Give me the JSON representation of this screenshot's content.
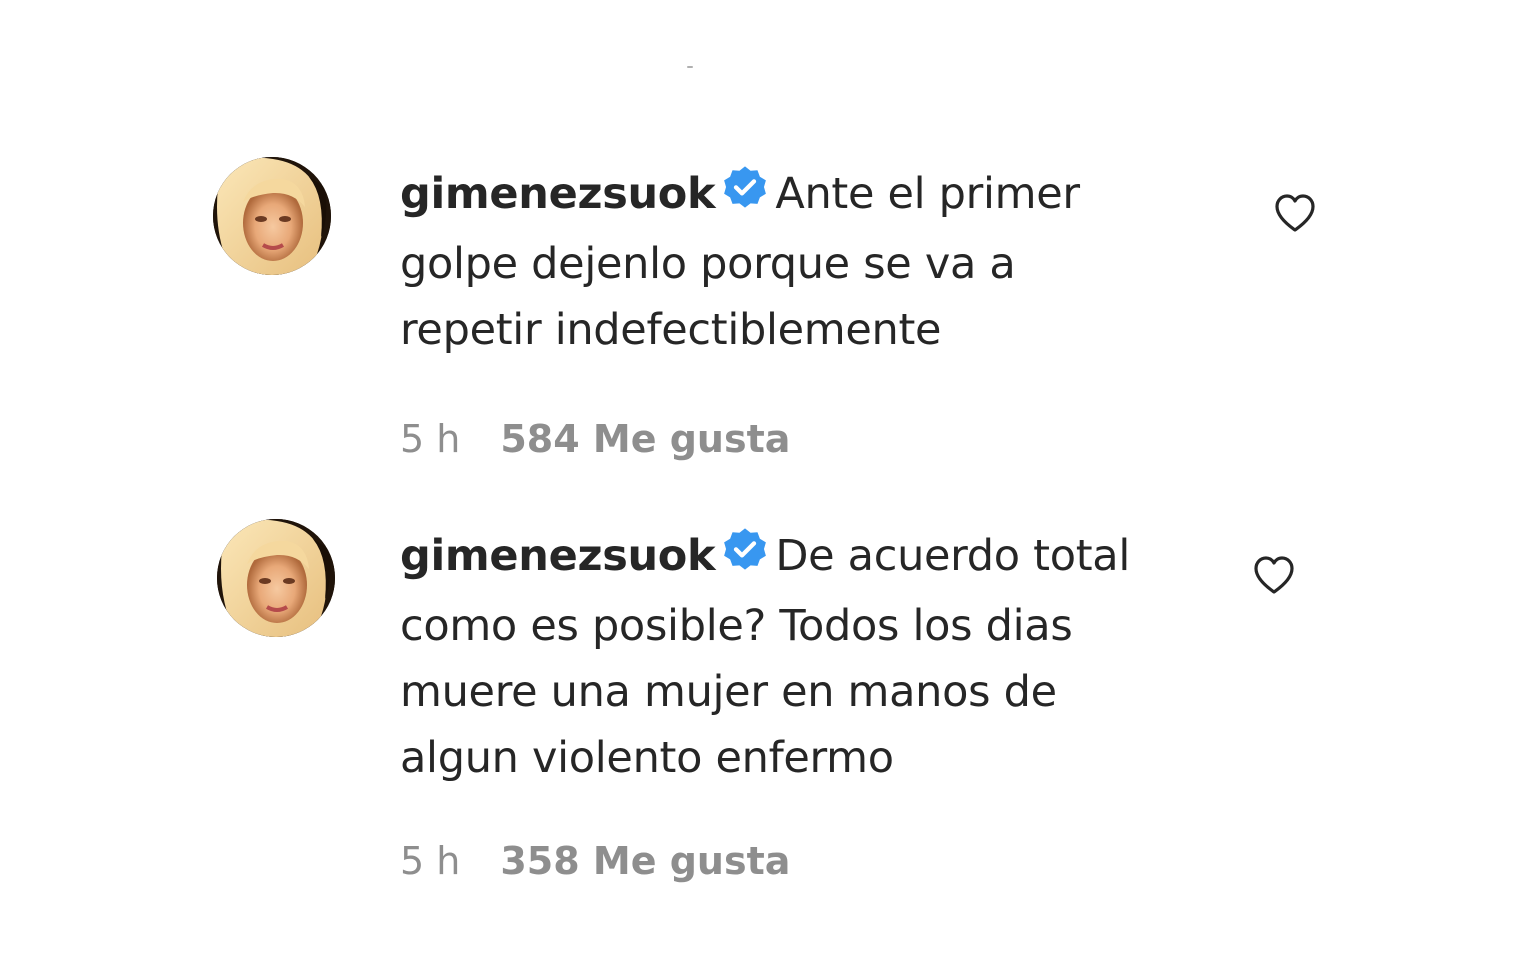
{
  "comments": [
    {
      "username": "gimenezsuok",
      "verified": true,
      "lines": [
        "Ante el primer",
        "golpe dejenlo porque se va a",
        "repetir indefectiblemente"
      ],
      "time": "5 h",
      "likes": "584 Me gusta",
      "avatar_icon": "profile-photo",
      "like_icon": "heart-outline-icon"
    },
    {
      "username": "gimenezsuok",
      "verified": true,
      "lines": [
        "De acuerdo total",
        "como es posible? Todos los dias",
        "muere una mujer en manos de",
        "algun violento enfermo"
      ],
      "time": "5 h",
      "likes": "358 Me gusta",
      "avatar_icon": "profile-photo",
      "like_icon": "heart-outline-icon"
    }
  ],
  "colors": {
    "text": "#262626",
    "meta": "#8e8e8e",
    "verified": "#3897f0"
  }
}
